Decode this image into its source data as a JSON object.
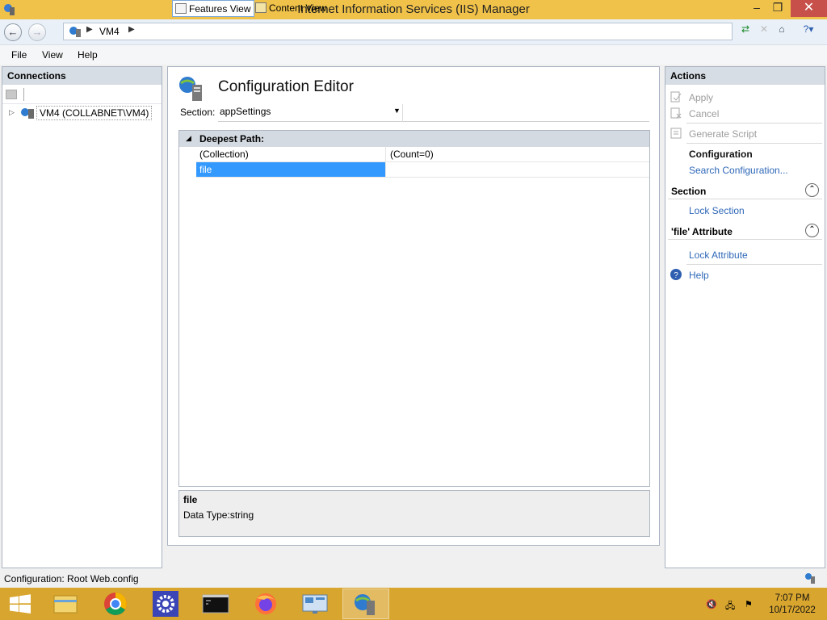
{
  "window": {
    "title": "Internet Information Services (IIS) Manager",
    "min": "–",
    "max": "❐",
    "close": "✕"
  },
  "address": {
    "crumbs": [
      "VM4"
    ]
  },
  "menu": {
    "items": [
      "File",
      "View",
      "Help"
    ]
  },
  "connections": {
    "header": "Connections",
    "tree": [
      {
        "label": "VM4 (COLLABNET\\VM4)",
        "expander": "▷"
      }
    ]
  },
  "editor": {
    "title": "Configuration Editor",
    "section_label": "Section:",
    "section_value": "appSettings",
    "group_title": "Deepest Path:",
    "rows": [
      {
        "name": "(Collection)",
        "value": "(Count=0)",
        "selected": false
      },
      {
        "name": "file",
        "value": "",
        "selected": true
      }
    ],
    "description": {
      "name": "file",
      "type": "Data Type:string"
    }
  },
  "view_tabs": {
    "features": "Features View",
    "content": "Content View"
  },
  "actions": {
    "header": "Actions",
    "apply": "Apply",
    "cancel": "Cancel",
    "generate_script": "Generate Script",
    "configuration": "Configuration",
    "search_configuration": "Search Configuration...",
    "section_group": "Section",
    "lock_section": "Lock Section",
    "attribute_group": "'file' Attribute",
    "lock_attribute": "Lock Attribute",
    "help": "Help"
  },
  "status": {
    "text": "Configuration: Root Web.config"
  },
  "taskbar": {
    "apps": [
      "start",
      "file-explorer",
      "chrome",
      "settings",
      "command-prompt",
      "firefox",
      "control-panel",
      "iis-manager"
    ],
    "time": "7:07 PM",
    "date": "10/17/2022"
  },
  "colors": {
    "titlebar": "#f0c24a",
    "taskbar": "#d8a52e",
    "selection": "#3399ff",
    "link": "#2f68b8"
  }
}
